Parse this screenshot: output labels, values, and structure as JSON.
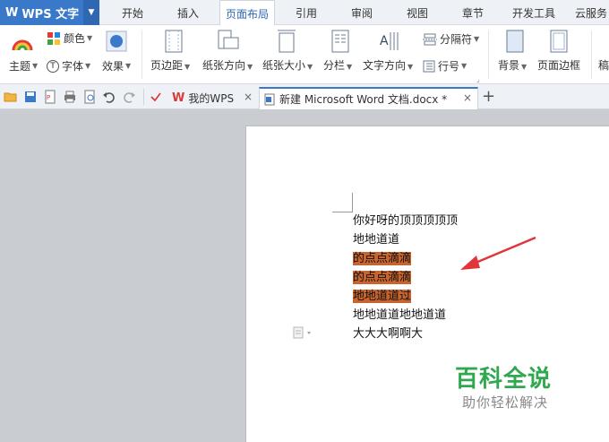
{
  "app": {
    "menu_label": "WPS 文字"
  },
  "menu_tabs": [
    "开始",
    "插入",
    "页面布局",
    "引用",
    "审阅",
    "视图",
    "章节",
    "开发工具",
    "云服务"
  ],
  "active_menu_tab": "页面布局",
  "ribbon": {
    "color_label": "颜色",
    "theme_label": "主题",
    "font_label": "字体",
    "effect_label": "效果",
    "margin_label": "页边距",
    "orientation_label": "纸张方向",
    "size_label": "纸张大小",
    "columns_label": "分栏",
    "text_direction_label": "文字方向",
    "separator_label": "分隔符",
    "line_number_label": "行号",
    "background_label": "背景",
    "page_border_label": "页面边框",
    "cut_label": "稿"
  },
  "doc_tabs": [
    {
      "label": "我的WPS"
    },
    {
      "label": "新建 Microsoft Word 文档.docx *"
    }
  ],
  "new_tab_symbol": "+",
  "close_symbol": "×",
  "document": {
    "lines": [
      {
        "text": "你好呀的顶顶顶顶顶",
        "highlight": false
      },
      {
        "text": "地地道道",
        "highlight": false
      },
      {
        "text": "的点点滴滴",
        "highlight": true
      },
      {
        "text": "的点点滴滴",
        "highlight": true
      },
      {
        "text": "地地道道过",
        "highlight": true
      },
      {
        "text": "地地道道地地道道",
        "highlight": false
      },
      {
        "text": "大大大啊啊大",
        "highlight": false
      }
    ],
    "highlight_color": "#c8642d"
  },
  "watermark": {
    "title": "百科全说",
    "subtitle": "助你轻松解决"
  },
  "colors": {
    "accent": "#3a78c9",
    "arrow": "#e0353b",
    "watermark_green": "#2fa84f"
  }
}
